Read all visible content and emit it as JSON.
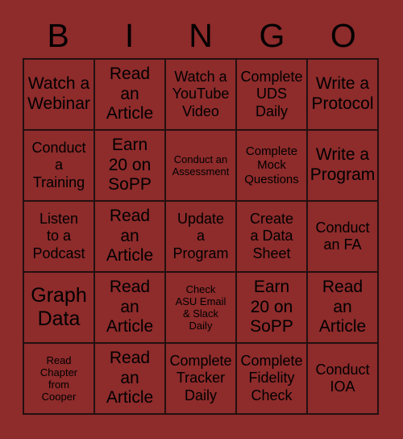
{
  "card": {
    "background_color": "#8E2B2B",
    "text_color": "#000000",
    "border_color": "#231010",
    "header": {
      "letters": [
        "B",
        "I",
        "N",
        "G",
        "O"
      ]
    },
    "grid": {
      "rows": 5,
      "columns": 5,
      "cells": [
        {
          "text": "Watch a\nWebinar",
          "size": "lg"
        },
        {
          "text": "Read\nan\nArticle",
          "size": "lg"
        },
        {
          "text": "Watch a\nYouTube\nVideo",
          "size": "md"
        },
        {
          "text": "Complete\nUDS\nDaily",
          "size": "md"
        },
        {
          "text": "Write a\nProtocol",
          "size": "lg"
        },
        {
          "text": "Conduct\na\nTraining",
          "size": "md"
        },
        {
          "text": "Earn\n20 on\nSoPP",
          "size": "lg"
        },
        {
          "text": "Conduct an\nAssessment",
          "size": "xs"
        },
        {
          "text": "Complete\nMock\nQuestions",
          "size": "sm"
        },
        {
          "text": "Write a\nProgram",
          "size": "lg"
        },
        {
          "text": "Listen\nto a\nPodcast",
          "size": "md"
        },
        {
          "text": "Read\nan\nArticle",
          "size": "lg"
        },
        {
          "text": "Update\na\nProgram",
          "size": "md"
        },
        {
          "text": "Create\na Data\nSheet",
          "size": "md"
        },
        {
          "text": "Conduct\nan FA",
          "size": "md"
        },
        {
          "text": "Graph\nData",
          "size": "xl"
        },
        {
          "text": "Read\nan\nArticle",
          "size": "lg"
        },
        {
          "text": "Check\nASU Email\n& Slack\nDaily",
          "size": "xs"
        },
        {
          "text": "Earn\n20 on\nSoPP",
          "size": "lg"
        },
        {
          "text": "Read\nan\nArticle",
          "size": "lg"
        },
        {
          "text": "Read\nChapter\nfrom\nCooper",
          "size": "xs"
        },
        {
          "text": "Read\nan\nArticle",
          "size": "lg"
        },
        {
          "text": "Complete\nTracker\nDaily",
          "size": "md"
        },
        {
          "text": "Complete\nFidelity\nCheck",
          "size": "md"
        },
        {
          "text": "Conduct\nIOA",
          "size": "md"
        }
      ]
    }
  }
}
